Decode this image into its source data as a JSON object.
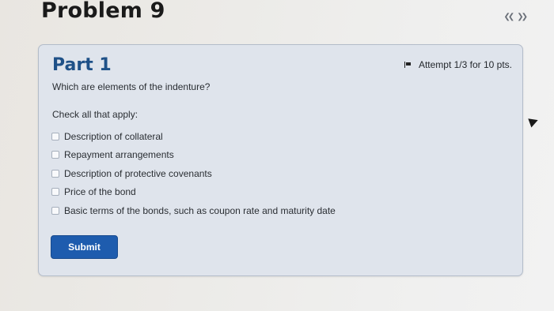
{
  "problem": {
    "title": "Problem 9",
    "nav_prev": "❮❮",
    "nav_next": "❯❯"
  },
  "part": {
    "title": "Part 1",
    "attempt": "Attempt 1/3 for 10 pts.",
    "question": "Which are elements of the indenture?",
    "instruction": "Check all that apply:",
    "options": [
      {
        "label": "Description of collateral",
        "checked": false
      },
      {
        "label": "Repayment arrangements",
        "checked": false
      },
      {
        "label": "Description of protective covenants",
        "checked": false
      },
      {
        "label": "Price of the bond",
        "checked": false
      },
      {
        "label": "Basic terms of the bonds, such as coupon rate and maturity date",
        "checked": false
      }
    ],
    "submit_label": "Submit"
  },
  "colors": {
    "accent": "#1f5188",
    "button": "#1e5cae",
    "card_bg": "#dfe4ec"
  },
  "icons": [
    "flag-icon",
    "double-chevron-left-icon",
    "double-chevron-right-icon",
    "mouse-pointer-icon"
  ]
}
